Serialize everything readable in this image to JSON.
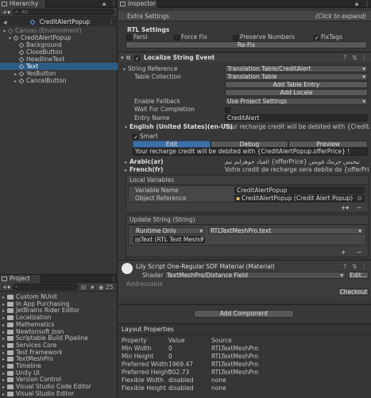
{
  "hierarchy": {
    "tab": "Hierarchy",
    "search_placeholder": "All",
    "scene": "CreditAlertPopup",
    "items": [
      {
        "label": "Canvas (Environment)",
        "indent": 1,
        "expanded": true,
        "dim": true
      },
      {
        "label": "CreditAlertPopup",
        "indent": 2,
        "expanded": true
      },
      {
        "label": "Background",
        "indent": 3
      },
      {
        "label": "CloseButton",
        "indent": 3
      },
      {
        "label": "HeadlineText",
        "indent": 3
      },
      {
        "label": "Text",
        "indent": 3,
        "selected": true
      },
      {
        "label": "YesButton",
        "indent": 3,
        "collapsed": true
      },
      {
        "label": "CancelButton",
        "indent": 3,
        "collapsed": true
      }
    ]
  },
  "project": {
    "tab": "Project",
    "count": "25",
    "items": [
      "Custom NUnit",
      "In App Purchasing",
      "JetBrains Rider Editor",
      "Localization",
      "Mathematics",
      "Newtonsoft Json",
      "Scriptable Build Pipeline",
      "Services Core",
      "Test Framework",
      "TextMeshPro",
      "Timeline",
      "Unity UI",
      "Version Control",
      "Visual Studio Code Editor",
      "Visual Studio Editor"
    ]
  },
  "inspector": {
    "tab": "Inspector",
    "extra_settings": "Extra Settings",
    "click_expand": "(Click to expand)",
    "rtl": {
      "title": "RTL Settings",
      "farsi": "Farsi",
      "force_fix": "Force Fix",
      "preserve_numbers": "Preserve Numbers",
      "fix_tags": "FixTags",
      "refix": "Re-Fix"
    },
    "localize": {
      "title": "Localize String Event",
      "string_reference": "String Reference",
      "string_reference_value": "Translation Table/CreditAlert",
      "table_collection": "Table Collection",
      "table_collection_value": "Translation Table",
      "add_table_entry": "Add Table Entry",
      "add_locale": "Add Locale",
      "enable_fallback": "Enable Fallback",
      "enable_fallback_value": "Use Project Settings",
      "wait_for_completion": "Wait For Completion",
      "entry_name": "Entry Name",
      "entry_name_value": "CreditAlert",
      "english": "English (United States)(en-US)",
      "english_value": "Your recharge credit will be debited with {CreditAlertPopup.offerPrice} !",
      "smart": "Smart",
      "tab_edit": "Edit",
      "tab_debug": "Debug",
      "tab_preview": "Preview",
      "preview_text": "Your recharge credit will be debited with {CreditAlertPopup.offerPrice} !",
      "arabic": "Arabic(ar)",
      "arabic_value": "الفباد خوهرابم نبم {offerPrice} نبحبس جرمك فوبس",
      "french": "French(fr)",
      "french_value": "Votre credit de recharge sera debite de {offerPrice} !",
      "local_variables": "Local Variables",
      "variable_name": "Variable Name",
      "variable_name_value": "CreditAlertPopup",
      "object_reference": "Object Reference",
      "object_reference_value": "CreditAlertPopup (Credit Alert Popup)",
      "update_string": "Update String (String)",
      "runtime_only": "Runtime Only",
      "method_value": "RTLTextMeshPro.text",
      "target_value": "Text (RTL Text Mesh F"
    },
    "material": {
      "title": "Lily Script One-Regular SDF Material (Material)",
      "shader_label": "Shader",
      "shader_value": "TextMeshPro/Distance Field",
      "edit": "Edit...",
      "addressable": "Addressable",
      "checkout": "Checkout"
    },
    "add_component": "Add Component",
    "layout": {
      "title": "Layout Properties",
      "headers": [
        "Property",
        "Value",
        "Source"
      ],
      "rows": [
        [
          "Min Width",
          "0",
          "RTLTextMeshPro"
        ],
        [
          "Min Height",
          "0",
          "RTLTextMeshPro"
        ],
        [
          "Preferred Width",
          "1969.47",
          "RTLTextMeshPro"
        ],
        [
          "Preferred Height",
          "302.73",
          "RTLTextMeshPro"
        ],
        [
          "Flexible Width",
          "disabled",
          "none"
        ],
        [
          "Flexible Height",
          "disabled",
          "none"
        ]
      ]
    }
  }
}
